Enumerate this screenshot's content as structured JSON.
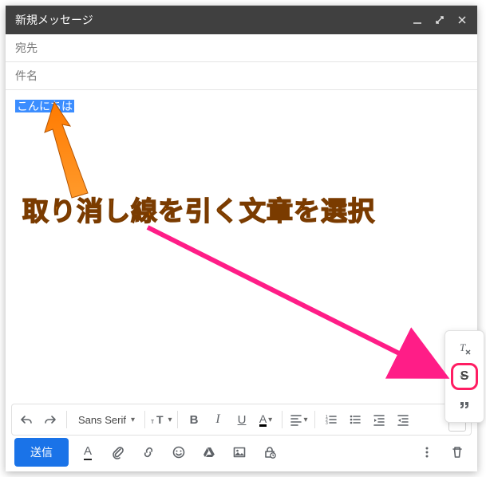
{
  "window": {
    "title": "新規メッセージ",
    "controls": {
      "minimize": "minimize-icon",
      "maximize": "expand-icon",
      "close": "close-icon"
    }
  },
  "fields": {
    "to_label": "宛先",
    "subject_label": "件名"
  },
  "body": {
    "selected_text": "こんにちは"
  },
  "annotation": {
    "text": "取り消し線を引く文章を選択"
  },
  "format_toolbar": {
    "undo": "undo-icon",
    "redo": "redo-icon",
    "font_name": "Sans Serif",
    "font_dd": "▾",
    "font_size": "size-icon",
    "bold": "B",
    "italic": "I",
    "underline": "U",
    "text_color": "A",
    "align": "align-left-icon",
    "list_numbered": "list-numbered-icon",
    "list_bulleted": "list-bulleted-icon",
    "indent_decrease": "indent-decrease-icon",
    "indent_increase": "indent-increase-icon",
    "more": "▾"
  },
  "extra_format": {
    "remove_format": "remove-format-icon",
    "strikethrough": "S",
    "quote": "quote-icon"
  },
  "send_bar": {
    "send_label": "送信",
    "text_style": "A",
    "attach": "attach-icon",
    "link": "link-icon",
    "emoji": "emoji-icon",
    "drive": "drive-icon",
    "photo": "photo-icon",
    "schedule": "schedule-lock-icon",
    "more": "more-icon",
    "delete": "trash-icon"
  },
  "colors": {
    "accent": "#1a73e8",
    "highlight": "#ff1d63",
    "annotation": "#e07b00",
    "selection": "#3b8dff"
  }
}
